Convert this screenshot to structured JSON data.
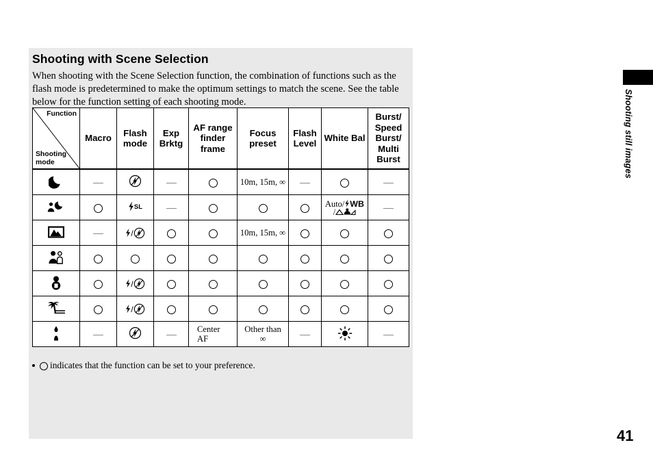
{
  "page": {
    "title": "Shooting with Scene Selection",
    "intro": "When shooting with the Scene Selection function, the combination of functions such as the flash mode is predetermined to make the optimum settings to match the scene. See the table below for the function setting of each shooting mode.",
    "number": "41",
    "side_tab_label": "Shooting still images",
    "panel_color": "#e9e9e9",
    "text_color": "#000000"
  },
  "table": {
    "corner": {
      "column_axis_label": "Function",
      "row_axis_label": "Shooting mode"
    },
    "columns": [
      {
        "key": "macro",
        "label": "Macro"
      },
      {
        "key": "flash",
        "label": "Flash mode"
      },
      {
        "key": "exp",
        "label": "Exp Brktg"
      },
      {
        "key": "af",
        "label": "AF range finder frame"
      },
      {
        "key": "focus",
        "label": "Focus preset"
      },
      {
        "key": "flevel",
        "label": "Flash Level"
      },
      {
        "key": "wb",
        "label": "White Bal"
      },
      {
        "key": "burst",
        "label": "Burst/ Speed Burst/ Multi Burst"
      }
    ],
    "rows": [
      {
        "mode_icon": "twilight-moon-icon",
        "macro": "—",
        "flash": "flash-off-icon",
        "exp": "—",
        "af": "○",
        "focus": "10m, 15m, ∞",
        "flevel": "—",
        "wb": "○",
        "burst": "—"
      },
      {
        "mode_icon": "twilight-portrait-icon",
        "macro": "○",
        "flash": "flash-slow-sync-icon",
        "flash_text": "SL",
        "exp": "—",
        "af": "○",
        "focus": "○",
        "flevel": "○",
        "wb": "Auto/⚡WB /◺◣",
        "wb_line1": "Auto/",
        "wb_line1_bold": "WB",
        "wb_line2": "/",
        "burst": "—"
      },
      {
        "mode_icon": "landscape-icon",
        "macro": "—",
        "flash": "flash-auto-or-off-icon",
        "exp": "○",
        "af": "○",
        "focus": "10m, 15m, ∞",
        "flevel": "○",
        "wb": "○",
        "burst": "○"
      },
      {
        "mode_icon": "soft-snap-people-icon",
        "macro": "○",
        "flash": "○",
        "exp": "○",
        "af": "○",
        "focus": "○",
        "flevel": "○",
        "wb": "○",
        "burst": "○"
      },
      {
        "mode_icon": "snow-snowman-icon",
        "macro": "○",
        "flash": "flash-auto-or-off-icon",
        "exp": "○",
        "af": "○",
        "focus": "○",
        "flevel": "○",
        "wb": "○",
        "burst": "○"
      },
      {
        "mode_icon": "beach-palm-tree-icon",
        "macro": "○",
        "flash": "flash-auto-or-off-icon",
        "exp": "○",
        "af": "○",
        "focus": "○",
        "flevel": "○",
        "wb": "○",
        "burst": "○"
      },
      {
        "mode_icon": "candle-icon",
        "macro": "—",
        "flash": "flash-off-icon",
        "exp": "—",
        "af": "Center AF",
        "af_line1": "Center",
        "af_line2": "AF",
        "focus": "Other than ∞",
        "focus_line1": "Other than",
        "focus_line2": "∞",
        "flevel": "—",
        "wb": "daylight-sun-icon",
        "burst": "—"
      }
    ]
  },
  "footnote": {
    "text": "indicates that the function can be set to your preference."
  }
}
